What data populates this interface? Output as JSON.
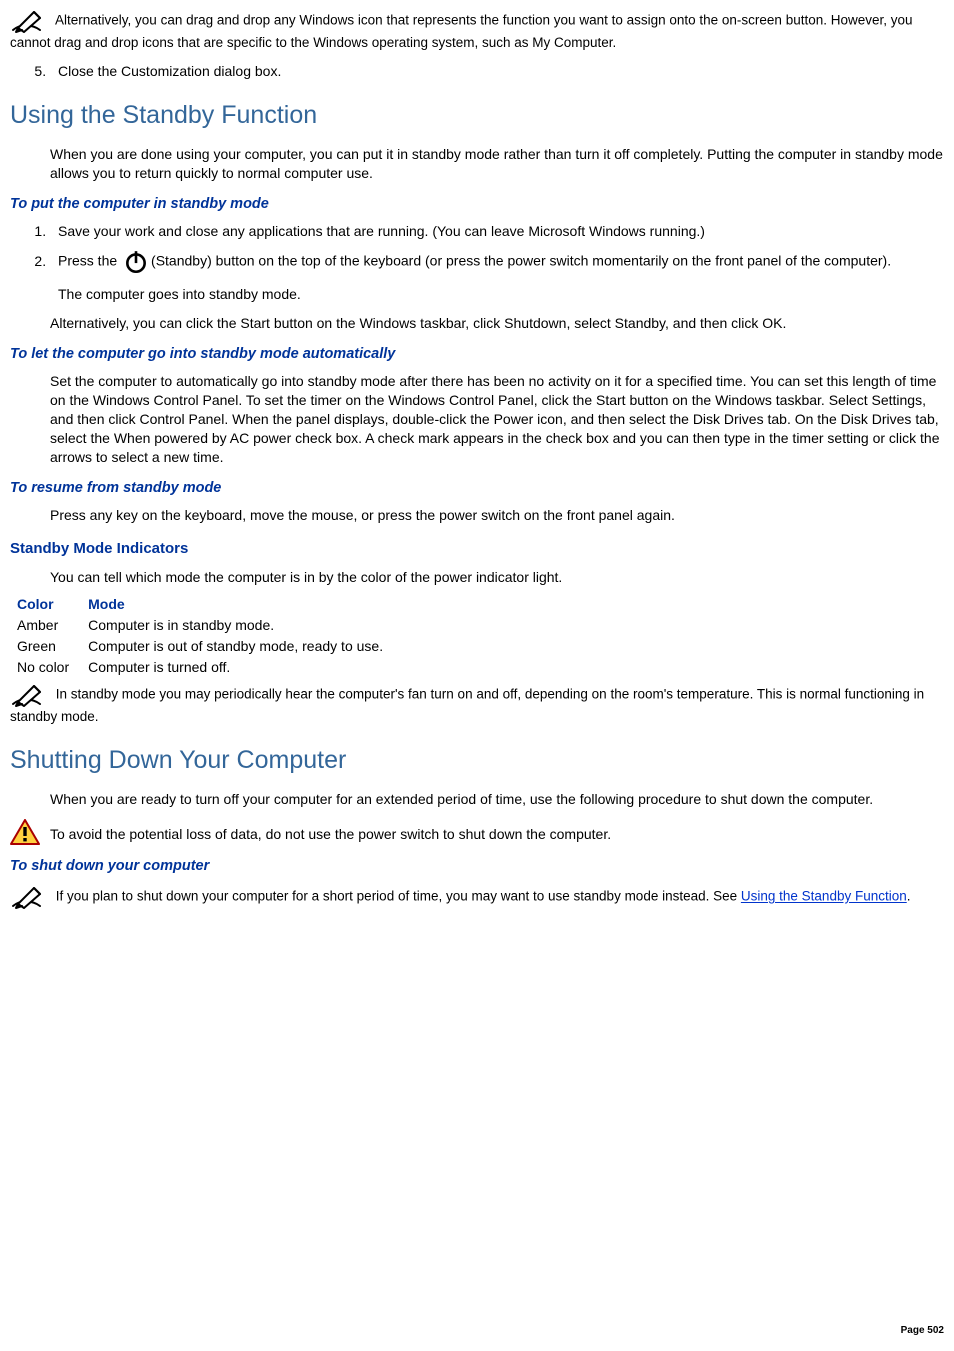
{
  "note1": "Alternatively, you can drag and drop any Windows icon that represents the function you want to assign onto the on-screen button. However, you cannot drag and drop icons that are specific to the Windows operating system, such as My Computer.",
  "ol1": {
    "item5": "Close the Customization dialog box."
  },
  "section1": {
    "heading": "Using the Standby Function",
    "intro": "When you are done using your computer, you can put it in standby mode rather than turn it off completely. Putting the computer in standby mode allows you to return quickly to normal computer use."
  },
  "sub1": {
    "heading": "To put the computer in standby mode",
    "ol": {
      "item1": "Save your work and close any applications that are running. (You can leave Microsoft Windows running.)",
      "item2_a": "Press the ",
      "item2_b": "(Standby) button on the top of the keyboard (or press the power switch momentarily on the front panel of the computer).",
      "item2_note": "The computer goes into standby mode."
    },
    "alt": "Alternatively, you can click the Start button on the Windows taskbar, click Shutdown, select Standby, and then click OK."
  },
  "sub2": {
    "heading": "To let the computer go into standby mode automatically",
    "body": "Set the computer to automatically go into standby mode after there has been no activity on it for a specified time. You can set this length of time on the Windows Control Panel. To set the timer on the Windows Control Panel, click the Start button on the Windows taskbar. Select Settings, and then click Control Panel. When the panel displays, double-click the Power icon, and then select the Disk Drives tab. On the Disk Drives tab, select the When powered by AC power check box. A check mark appears in the check box and you can then type in the timer setting or click the arrows to select a new time."
  },
  "sub3": {
    "heading": "To resume from standby mode",
    "body": "Press any key on the keyboard, move the mouse, or press the power switch on the front panel again."
  },
  "sub4": {
    "heading": "Standby Mode Indicators",
    "intro": "You can tell which mode the computer is in by the color of the power indicator light.",
    "table": {
      "h1": "Color",
      "h2": "Mode",
      "rows": [
        {
          "color": "Amber",
          "mode": "Computer is in standby mode."
        },
        {
          "color": "Green",
          "mode": "Computer is out of standby mode, ready to use."
        },
        {
          "color": "No color",
          "mode": "Computer is turned off."
        }
      ]
    },
    "note": "In standby mode you may periodically hear the computer's fan turn on and off, depending on the room's temperature. This is normal functioning in standby mode."
  },
  "section2": {
    "heading": "Shutting Down Your Computer",
    "intro": "When you are ready to turn off your computer for an extended period of time, use the following procedure to shut down the computer.",
    "caution": "To avoid the potential loss of data, do not use the power switch to shut down the computer."
  },
  "sub5": {
    "heading": "To shut down your computer",
    "note_a": "If you plan to shut down your computer for a short period of time, you may want to use standby mode instead. See ",
    "note_link": "Using the Standby Function",
    "note_b": "."
  },
  "page": "Page 502"
}
